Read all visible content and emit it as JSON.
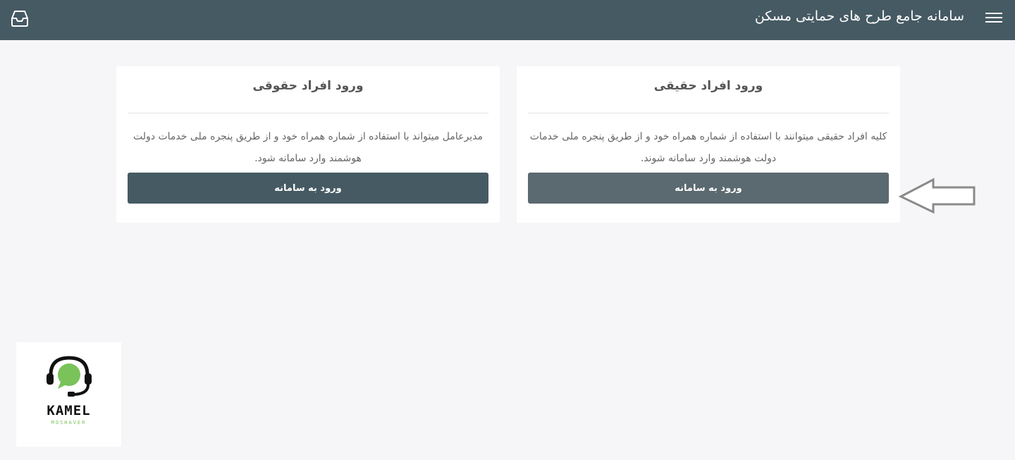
{
  "header": {
    "title": "سامانه جامع طرح های حمایتی مسکن",
    "menu_icon": "hamburger-menu-icon",
    "inbox_icon": "inbox-tray-icon",
    "background_color": "#465a63"
  },
  "cards": {
    "real": {
      "title": "ورود افراد حقیقی",
      "description": "کلیه افراد حقیقی میتوانند با استفاده از شماره همراه خود و از طریق پنجره ملی خدمات دولت هوشمند وارد سامانه شوند.",
      "button_label": "ورود به سامانه"
    },
    "legal": {
      "title": "ورود افراد حقوقی",
      "description": "مدیرعامل میتواند با استفاده از شماره همراه خود و از طریق پنجره ملی خدمات دولت هوشمند وارد سامانه شود.",
      "button_label": "ورود به سامانه"
    }
  },
  "annotation": {
    "icon": "left-arrow-outline-icon"
  },
  "logo": {
    "main_text": "KAMEL",
    "sub_text": "MOSHAVER",
    "accent_color": "#79c35a"
  }
}
